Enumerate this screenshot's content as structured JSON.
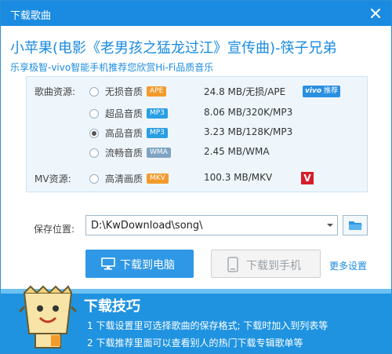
{
  "window": {
    "title": "下载歌曲"
  },
  "song": {
    "title": "小苹果(电影《老男孩之猛龙过江》宣传曲)-筷子兄弟",
    "promo": "乐享极智-vivo智能手机推荐您欣赏Hi-Fi品质音乐"
  },
  "song_group": {
    "label": "歌曲资源:"
  },
  "mv_group": {
    "label": "MV资源:"
  },
  "qualities": [
    {
      "name": "无损音质",
      "badge": "APE",
      "badge_color": "#f39a2b",
      "info": "24.8 MB/无损/APE",
      "selected": false
    },
    {
      "name": "超品音质",
      "badge": "MP3",
      "badge_color": "#2a9fe3",
      "info": "8.06 MB/320K/MP3",
      "selected": false
    },
    {
      "name": "高品音质",
      "badge": "MP3",
      "badge_color": "#2a9fe3",
      "info": "3.23 MB/128K/MP3",
      "selected": true
    },
    {
      "name": "流畅音质",
      "badge": "WMA",
      "badge_color": "#7fa3c2",
      "info": "2.45 MB/WMA",
      "selected": false
    }
  ],
  "mv": {
    "name": "高清画质",
    "badge": "MKV",
    "badge_color": "#f39a2b",
    "info": "100.3 MB/MKV",
    "selected": false,
    "v_label": "V"
  },
  "vivo_badge": {
    "logo": "vivo",
    "text": "推荐"
  },
  "save": {
    "label": "保存位置:",
    "path": "D:\\KwDownload\\song\\"
  },
  "buttons": {
    "download_pc": "下载到电脑",
    "download_phone": "下载到手机",
    "more_settings": "更多设置"
  },
  "tips": {
    "heading": "下载技巧",
    "tip1": "1 下载设置里可选择歌曲的保存格式; 下载时加入到列表等",
    "tip2": "2 下载推荐里面可以查看别人的热门下载专辑歌单等"
  },
  "colors": {
    "accent": "#1a8be0",
    "tips_bg": "#1f93e0"
  }
}
